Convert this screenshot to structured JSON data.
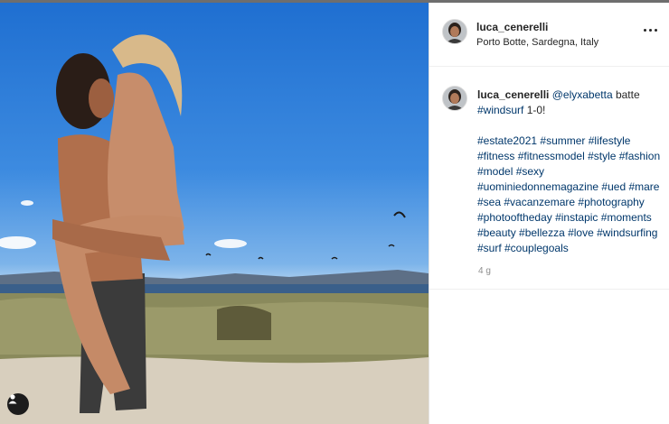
{
  "post": {
    "username": "luca_cenerelli",
    "location": "Porto Botte, Sardegna, Italy",
    "caption_mention": "@elyxabetta",
    "caption_text": " batte",
    "caption_tag": "#windsurf",
    "caption_end": " 1-0!",
    "hashtag_lines": [
      "#estate2021 #summer #lifestyle",
      "#fitness #fitnessmodel #style #fashion",
      "#model #sexy",
      "#uominiedonnemagazine #ued #mare",
      "#sea #vacanzemare #photography",
      "#photooftheday #instapic #moments",
      "#beauty #bellezza #love #windsurfing",
      "#surf #couplegoals"
    ],
    "time_ago": "4 g"
  },
  "icons": {
    "more": "more-options-icon",
    "user_tag": "user-tag-icon"
  },
  "colors": {
    "sky": "#2f7fdc",
    "link": "#00376b",
    "text": "#262626",
    "muted": "#8e8e8e"
  }
}
